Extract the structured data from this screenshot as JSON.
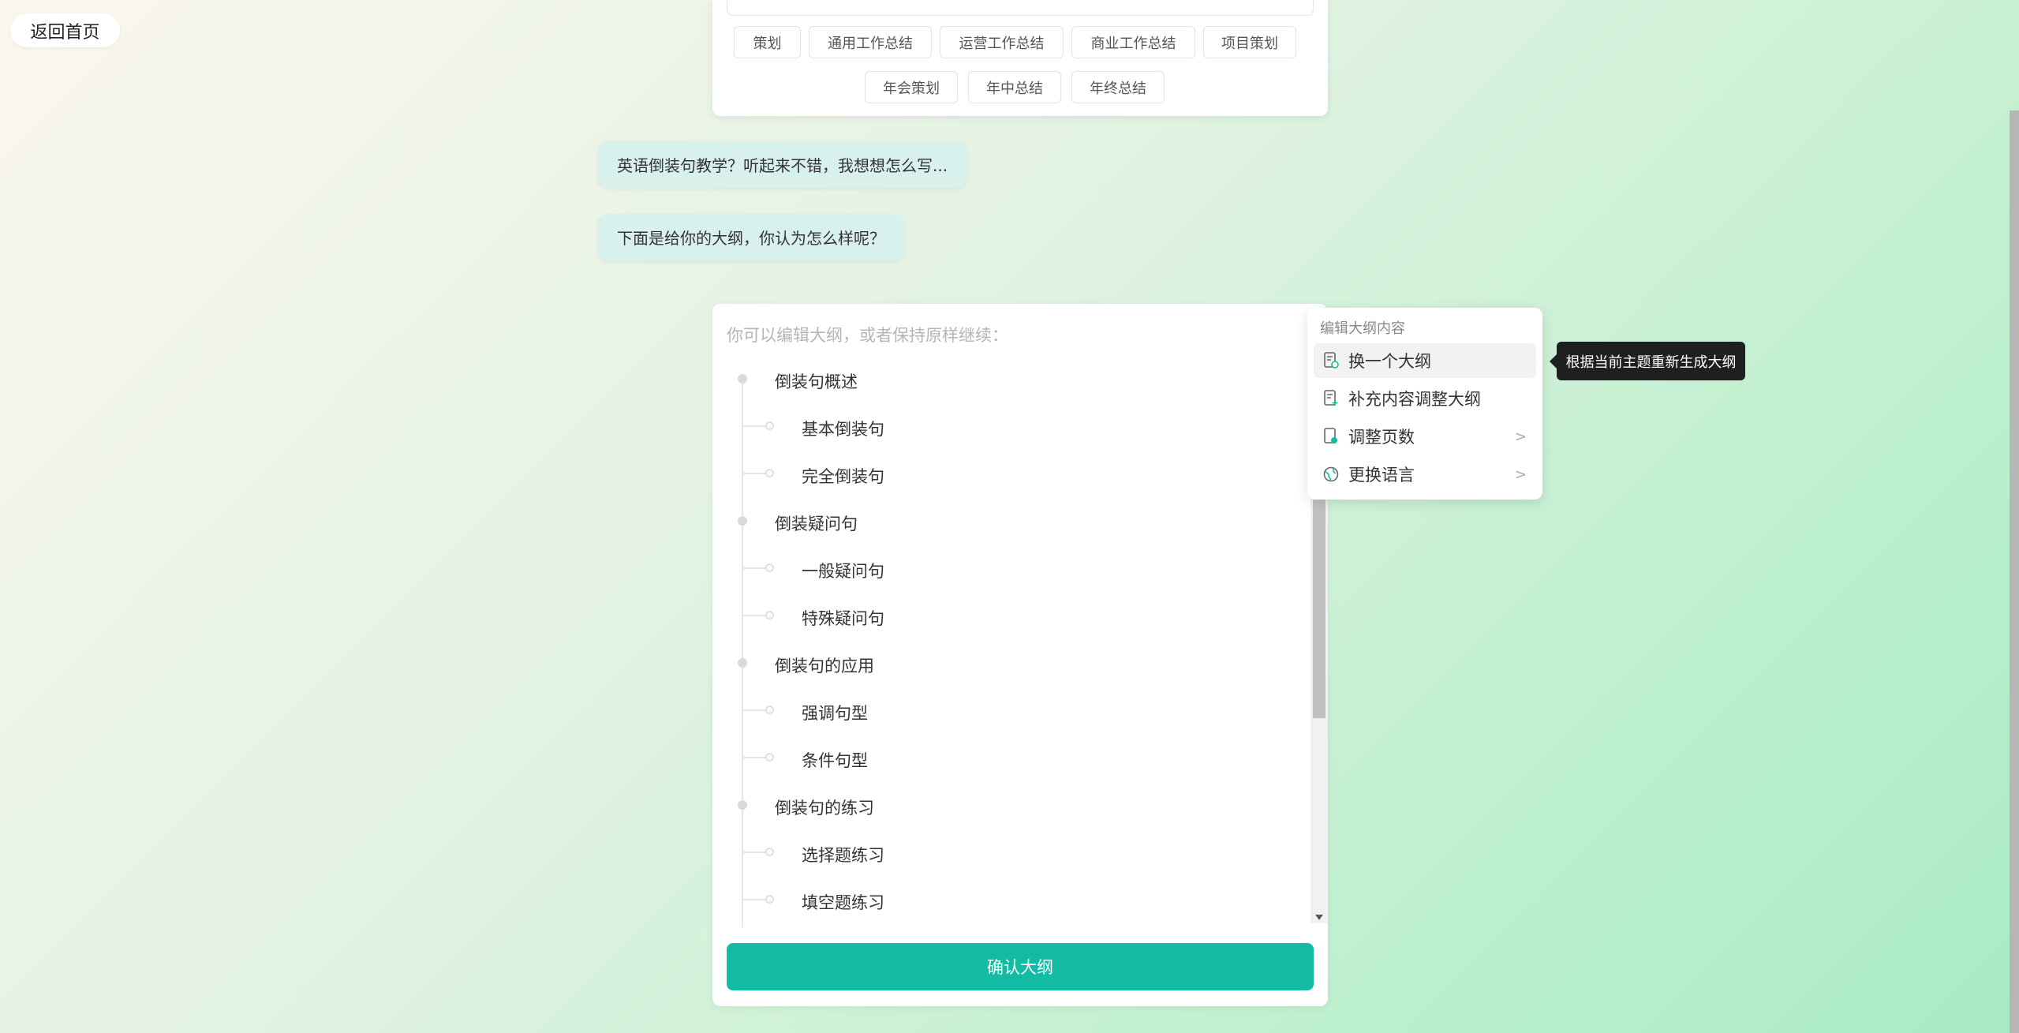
{
  "header": {
    "back_label": "返回首页"
  },
  "tags": [
    "策划",
    "通用工作总结",
    "运营工作总结",
    "商业工作总结",
    "项目策划",
    "年会策划",
    "年中总结",
    "年终总结"
  ],
  "chat": [
    "英语倒装句教学？听起来不错，我想想怎么写...",
    "下面是给你的大纲，你认为怎么样呢？"
  ],
  "outline": {
    "hint": "你可以编辑大纲，或者保持原样继续：",
    "sections": [
      {
        "title": "倒装句概述",
        "items": [
          "基本倒装句",
          "完全倒装句"
        ]
      },
      {
        "title": "倒装疑问句",
        "items": [
          "一般疑问句",
          "特殊疑问句"
        ]
      },
      {
        "title": "倒装句的应用",
        "items": [
          "强调句型",
          "条件句型"
        ]
      },
      {
        "title": "倒装句的练习",
        "items": [
          "选择题练习",
          "填空题练习"
        ]
      }
    ],
    "confirm_label": "确认大纲"
  },
  "menu": {
    "title": "编辑大纲内容",
    "items": [
      {
        "label": "换一个大纲",
        "icon": "doc-refresh-icon"
      },
      {
        "label": "补充内容调整大纲",
        "icon": "doc-add-icon"
      },
      {
        "label": "调整页数",
        "icon": "page-count-icon"
      },
      {
        "label": "更换语言",
        "icon": "language-icon"
      }
    ]
  },
  "tooltip": "根据当前主题重新生成大纲",
  "colors": {
    "primary": "#14bba4",
    "bubble": "#d8f1ed"
  }
}
